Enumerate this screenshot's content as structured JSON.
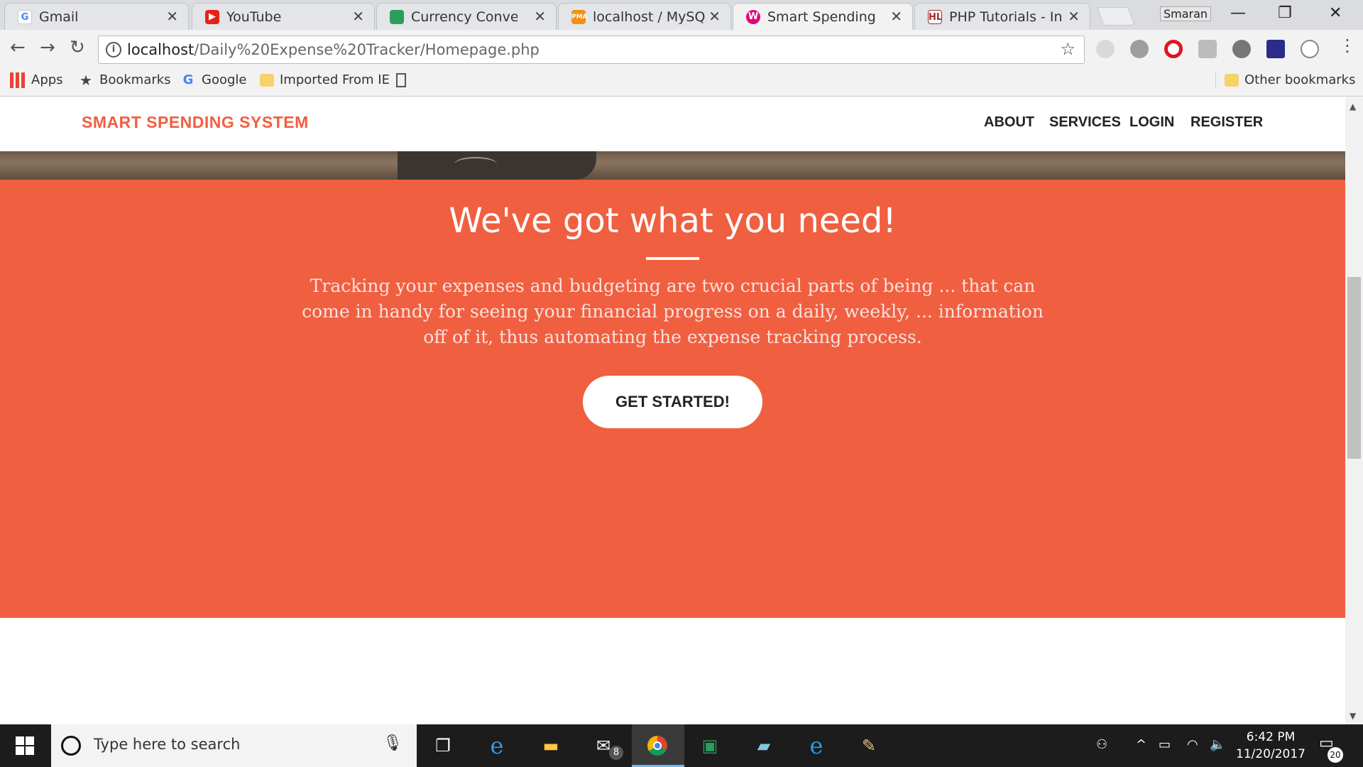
{
  "browser": {
    "tabs": [
      {
        "title": "Gmail",
        "icon": "google-icon",
        "color": "#4285f4"
      },
      {
        "title": "YouTube",
        "icon": "youtube-icon",
        "color": "#e62117"
      },
      {
        "title": "Currency Converter",
        "icon": "sheets-icon",
        "color": "#2b9d5c"
      },
      {
        "title": "localhost / MySQL /",
        "icon": "phpmyadmin-icon",
        "color": "#f29111"
      },
      {
        "title": "Smart Spending Syst",
        "icon": "site-icon",
        "color": "#e6007e",
        "active": true
      },
      {
        "title": "PHP Tutorials - Insta",
        "icon": "hl-icon",
        "color": "#a42b2b"
      }
    ],
    "profile_name": "Smaran",
    "url_host": "localhost",
    "url_path": "/Daily%20Expense%20Tracker/Homepage.php",
    "bookmarks": [
      {
        "label": "Apps",
        "icon": "apps-grid-icon"
      },
      {
        "label": "Bookmarks",
        "icon": "star-icon"
      },
      {
        "label": "Google",
        "icon": "google-icon"
      },
      {
        "label": "Imported From IE",
        "icon": "folder-icon"
      },
      {
        "label": "",
        "icon": "page-icon"
      }
    ],
    "other_bookmarks": "Other bookmarks"
  },
  "site": {
    "brand": "SMART SPENDING SYSTEM",
    "nav": [
      "ABOUT",
      "SERVICES",
      "LOGIN",
      "REGISTER"
    ],
    "accent_color": "#f05f40",
    "section": {
      "heading": "We've got what you need!",
      "text": "Tracking your expenses and budgeting are two crucial parts of being ... that can come in handy for seeing your financial progress on a daily, weekly, ... information off of it, thus automating the expense tracking process.",
      "cta": "GET STARTED!"
    }
  },
  "taskbar": {
    "search_placeholder": "Type here to search",
    "mail_badge": "8",
    "time": "6:42 PM",
    "date": "11/20/2017",
    "notification_count": "20"
  }
}
